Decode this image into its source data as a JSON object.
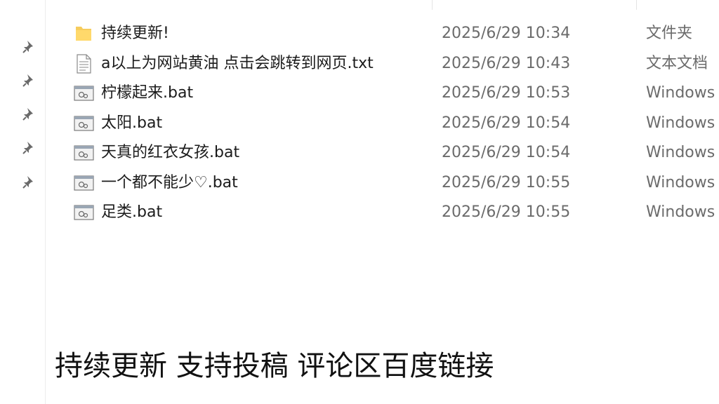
{
  "files": [
    {
      "name": "持续更新!",
      "date": "2025/6/29 10:34",
      "type": "文件夹",
      "icon": "folder-icon"
    },
    {
      "name": "a以上为网站黄油 点击会跳转到网页.txt",
      "date": "2025/6/29 10:43",
      "type": "文本文档",
      "icon": "text-file-icon"
    },
    {
      "name": "柠檬起来.bat",
      "date": "2025/6/29 10:53",
      "type": "Windows",
      "icon": "batch-file-icon"
    },
    {
      "name": "太阳.bat",
      "date": "2025/6/29 10:54",
      "type": "Windows",
      "icon": "batch-file-icon"
    },
    {
      "name": "天真的红衣女孩.bat",
      "date": "2025/6/29 10:54",
      "type": "Windows",
      "icon": "batch-file-icon"
    },
    {
      "name": "一个都不能少♡.bat",
      "date": "2025/6/29 10:55",
      "type": "Windows",
      "icon": "batch-file-icon"
    },
    {
      "name": "足类.bat",
      "date": "2025/6/29 10:55",
      "type": "Windows",
      "icon": "batch-file-icon"
    }
  ],
  "nav_pins": [
    "pin-icon",
    "pin-icon",
    "pin-icon",
    "pin-icon",
    "pin-icon"
  ],
  "caption": "持续更新 支持投稿 评论区百度链接",
  "colors": {
    "folder": "#f6cc5d",
    "text_secondary": "#6b6b6b",
    "pin": "#6a6a6a"
  }
}
